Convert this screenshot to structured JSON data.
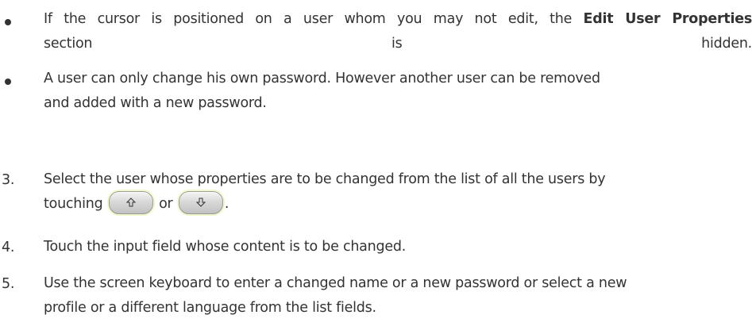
{
  "bullets": [
    {
      "line1_pre": "If the cursor is positioned on a user whom you may not edit, the ",
      "line1_bold": "Edit User Properties",
      "line2": "section is hidden."
    },
    {
      "line1": "A user can only change his own password. However another user can be removed",
      "line2": "and added with a new password."
    }
  ],
  "steps": [
    {
      "number": "3.",
      "line1": "Select the user whose properties are to be changed from the list of all the users by",
      "line2_pre": "touching",
      "line2_mid": "or",
      "line2_post": "."
    },
    {
      "number": "4.",
      "line1": "Touch the input field whose content is to be changed."
    },
    {
      "number": "5.",
      "line1": "Use the screen keyboard to enter a changed name or a new password or select a new",
      "line2": "profile or a different language from the list fields."
    }
  ],
  "icons": {
    "up_key": "arrow-up-key-icon",
    "down_key": "arrow-down-key-icon"
  },
  "colors": {
    "text": "#333333",
    "key_highlight": "#f0f7c8"
  }
}
